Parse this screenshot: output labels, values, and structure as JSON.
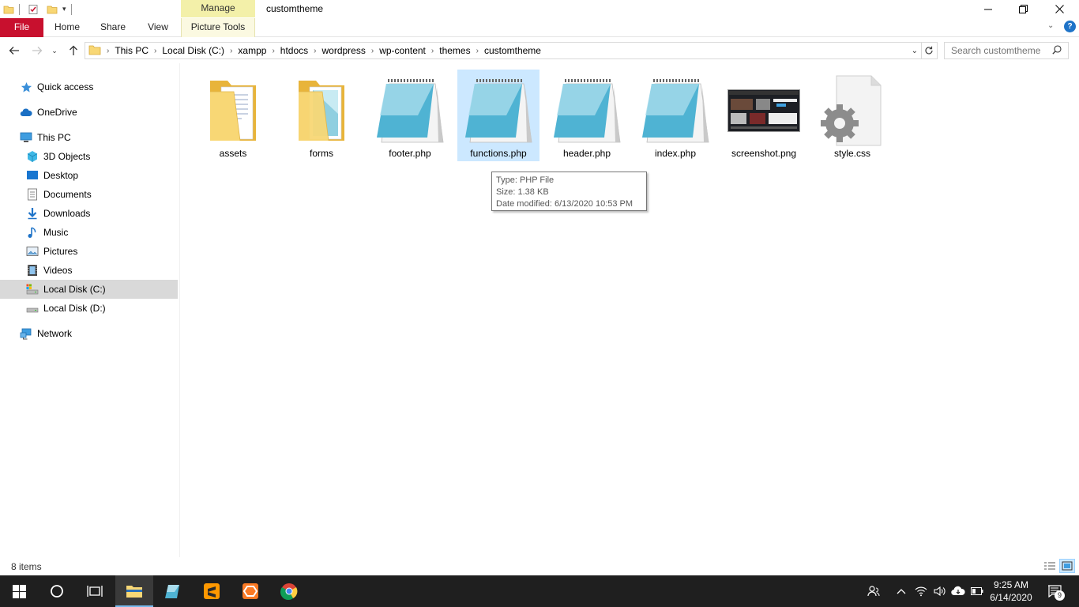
{
  "window": {
    "title": "customtheme",
    "contextual_tab": "Manage",
    "contextual_group": "Picture Tools"
  },
  "ribbon": {
    "tabs": [
      "File",
      "Home",
      "Share",
      "View",
      "Picture Tools"
    ]
  },
  "address": {
    "crumbs": [
      "This PC",
      "Local Disk (C:)",
      "xampp",
      "htdocs",
      "wordpress",
      "wp-content",
      "themes",
      "customtheme"
    ]
  },
  "search": {
    "placeholder": "Search customtheme"
  },
  "navpane": {
    "items": [
      {
        "label": "Quick access",
        "icon": "star-icon"
      },
      {
        "label": "OneDrive",
        "icon": "cloud-icon"
      },
      {
        "label": "This PC",
        "icon": "computer-icon"
      },
      {
        "label": "3D Objects",
        "icon": "cube-icon"
      },
      {
        "label": "Desktop",
        "icon": "desktop-icon"
      },
      {
        "label": "Documents",
        "icon": "document-icon"
      },
      {
        "label": "Downloads",
        "icon": "download-icon"
      },
      {
        "label": "Music",
        "icon": "music-icon"
      },
      {
        "label": "Pictures",
        "icon": "pictures-icon"
      },
      {
        "label": "Videos",
        "icon": "video-icon"
      },
      {
        "label": "Local Disk (C:)",
        "icon": "drive-icon"
      },
      {
        "label": "Local Disk (D:)",
        "icon": "drive-icon"
      },
      {
        "label": "Network",
        "icon": "network-icon"
      }
    ]
  },
  "files": [
    {
      "name": "assets",
      "type": "folder"
    },
    {
      "name": "forms",
      "type": "folder"
    },
    {
      "name": "footer.php",
      "type": "php"
    },
    {
      "name": "functions.php",
      "type": "php"
    },
    {
      "name": "header.php",
      "type": "php"
    },
    {
      "name": "index.php",
      "type": "php"
    },
    {
      "name": "screenshot.png",
      "type": "image"
    },
    {
      "name": "style.css",
      "type": "css"
    }
  ],
  "tooltip": {
    "type": "Type: PHP File",
    "size": "Size: 1.38 KB",
    "modified": "Date modified: 6/13/2020 10:53 PM"
  },
  "status": {
    "count": "8 items"
  },
  "taskbar": {
    "time": "9:25 AM",
    "date": "6/14/2020",
    "notification_count": "9"
  },
  "colors": {
    "file_tab": "#c8102e",
    "manage_tab": "#f3f0a9",
    "selection": "#cce8ff",
    "taskbar": "#1f1f1f"
  }
}
